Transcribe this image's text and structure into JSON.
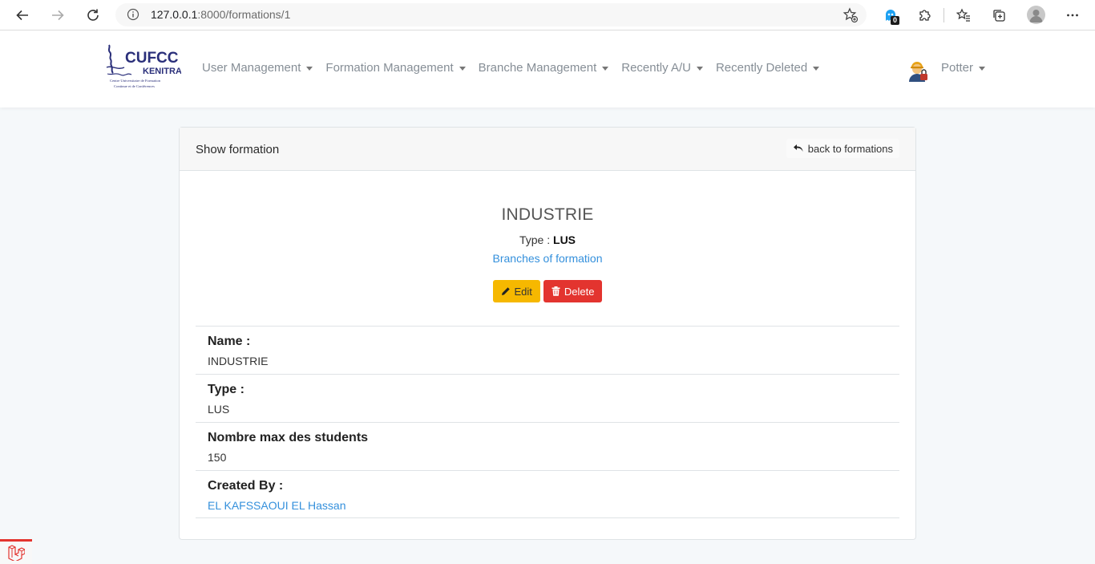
{
  "browser": {
    "url_host": "127.0.0.1",
    "url_path": ":8000/formations/1",
    "extension_badge": "0"
  },
  "navbar": {
    "logo_text": "CUFCC",
    "logo_subtitle": "KENITRA",
    "logo_caption_1": "Centre Universitaire de Formation",
    "logo_caption_2": "Continue et de Conférences",
    "menu": [
      {
        "label": "User Management"
      },
      {
        "label": "Formation Management"
      },
      {
        "label": "Branche Management"
      },
      {
        "label": "Recently A/U"
      },
      {
        "label": "Recently Deleted"
      }
    ],
    "user_name": "Potter"
  },
  "card": {
    "header_title": "Show formation",
    "back_label": "back to formations",
    "formation_name": "INDUSTRIE",
    "type_prefix": "Type :",
    "type_value": "LUS",
    "branches_link": "Branches of formation",
    "edit_label": "Edit",
    "delete_label": "Delete",
    "details": [
      {
        "label": "Name :",
        "value": "INDUSTRIE",
        "is_link": false
      },
      {
        "label": "Type :",
        "value": "LUS",
        "is_link": false
      },
      {
        "label": "Nombre max des students",
        "value": "150",
        "is_link": false
      },
      {
        "label": "Created By :",
        "value": "EL KAFSSAOUI EL Hassan",
        "is_link": true
      }
    ]
  },
  "colors": {
    "link": "#3490dc",
    "edit": "#f6b800",
    "delete": "#e3342f",
    "background": "#f5f8fa"
  }
}
